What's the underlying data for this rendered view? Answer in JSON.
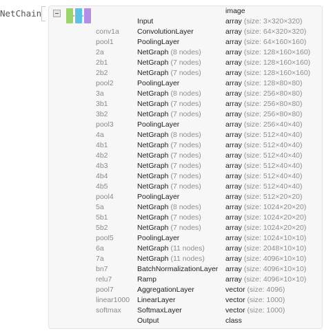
{
  "head": "NetChain",
  "header_port": "image",
  "colors": {
    "thumb_green": "#9bd36c",
    "thumb_cyan": "#5cc3e6",
    "thumb_purple": "#b48ee6"
  },
  "rows": [
    {
      "n": "",
      "t": "Input",
      "tn": "",
      "k": "array",
      "s": "(size: 3×320×320)"
    },
    {
      "n": "conv1a",
      "t": "ConvolutionLayer",
      "tn": "",
      "k": "array",
      "s": "(size: 64×320×320)"
    },
    {
      "n": "pool1",
      "t": "PoolingLayer",
      "tn": "",
      "k": "array",
      "s": "(size: 64×160×160)"
    },
    {
      "n": "2a",
      "t": "NetGraph",
      "tn": "(8 nodes)",
      "k": "array",
      "s": "(size: 128×160×160)"
    },
    {
      "n": "2b1",
      "t": "NetGraph",
      "tn": "(7 nodes)",
      "k": "array",
      "s": "(size: 128×160×160)"
    },
    {
      "n": "2b2",
      "t": "NetGraph",
      "tn": "(7 nodes)",
      "k": "array",
      "s": "(size: 128×160×160)"
    },
    {
      "n": "pool2",
      "t": "PoolingLayer",
      "tn": "",
      "k": "array",
      "s": "(size: 128×80×80)"
    },
    {
      "n": "3a",
      "t": "NetGraph",
      "tn": "(8 nodes)",
      "k": "array",
      "s": "(size: 256×80×80)"
    },
    {
      "n": "3b1",
      "t": "NetGraph",
      "tn": "(7 nodes)",
      "k": "array",
      "s": "(size: 256×80×80)"
    },
    {
      "n": "3b2",
      "t": "NetGraph",
      "tn": "(7 nodes)",
      "k": "array",
      "s": "(size: 256×80×80)"
    },
    {
      "n": "pool3",
      "t": "PoolingLayer",
      "tn": "",
      "k": "array",
      "s": "(size: 256×40×40)"
    },
    {
      "n": "4a",
      "t": "NetGraph",
      "tn": "(8 nodes)",
      "k": "array",
      "s": "(size: 512×40×40)"
    },
    {
      "n": "4b1",
      "t": "NetGraph",
      "tn": "(7 nodes)",
      "k": "array",
      "s": "(size: 512×40×40)"
    },
    {
      "n": "4b2",
      "t": "NetGraph",
      "tn": "(7 nodes)",
      "k": "array",
      "s": "(size: 512×40×40)"
    },
    {
      "n": "4b3",
      "t": "NetGraph",
      "tn": "(7 nodes)",
      "k": "array",
      "s": "(size: 512×40×40)"
    },
    {
      "n": "4b4",
      "t": "NetGraph",
      "tn": "(7 nodes)",
      "k": "array",
      "s": "(size: 512×40×40)"
    },
    {
      "n": "4b5",
      "t": "NetGraph",
      "tn": "(7 nodes)",
      "k": "array",
      "s": "(size: 512×40×40)"
    },
    {
      "n": "pool4",
      "t": "PoolingLayer",
      "tn": "",
      "k": "array",
      "s": "(size: 512×20×20)"
    },
    {
      "n": "5a",
      "t": "NetGraph",
      "tn": "(8 nodes)",
      "k": "array",
      "s": "(size: 1024×20×20)"
    },
    {
      "n": "5b1",
      "t": "NetGraph",
      "tn": "(7 nodes)",
      "k": "array",
      "s": "(size: 1024×20×20)"
    },
    {
      "n": "5b2",
      "t": "NetGraph",
      "tn": "(7 nodes)",
      "k": "array",
      "s": "(size: 1024×20×20)"
    },
    {
      "n": "pool5",
      "t": "PoolingLayer",
      "tn": "",
      "k": "array",
      "s": "(size: 1024×10×10)"
    },
    {
      "n": "6a",
      "t": "NetGraph",
      "tn": "(11 nodes)",
      "k": "array",
      "s": "(size: 2048×10×10)"
    },
    {
      "n": "7a",
      "t": "NetGraph",
      "tn": "(11 nodes)",
      "k": "array",
      "s": "(size: 4096×10×10)"
    },
    {
      "n": "bn7",
      "t": "BatchNormalizationLayer",
      "tn": "",
      "k": "array",
      "s": "(size: 4096×10×10)"
    },
    {
      "n": "relu7",
      "t": "Ramp",
      "tn": "",
      "k": "array",
      "s": "(size: 4096×10×10)"
    },
    {
      "n": "pool7",
      "t": "AggregationLayer",
      "tn": "",
      "k": "vector",
      "s": "(size: 4096)"
    },
    {
      "n": "linear1000",
      "t": "LinearLayer",
      "tn": "",
      "k": "vector",
      "s": "(size: 1000)"
    },
    {
      "n": "softmax",
      "t": "SoftmaxLayer",
      "tn": "",
      "k": "vector",
      "s": "(size: 1000)"
    },
    {
      "n": "",
      "t": "Output",
      "tn": "",
      "k": "class",
      "s": ""
    }
  ]
}
